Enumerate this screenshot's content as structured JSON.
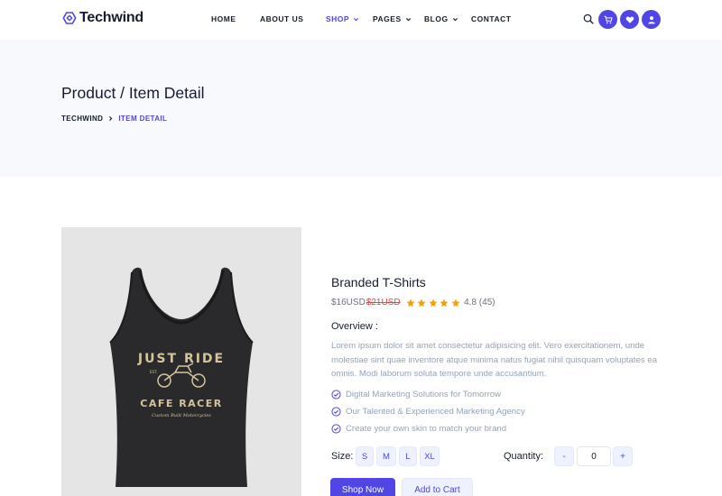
{
  "brand": {
    "name": "Techwind",
    "accent": "#4f46e5"
  },
  "nav": {
    "items": [
      {
        "label": "HOME",
        "dropdown": false,
        "active": false
      },
      {
        "label": "ABOUT US",
        "dropdown": false,
        "active": false
      },
      {
        "label": "SHOP",
        "dropdown": true,
        "active": true
      },
      {
        "label": "PAGES",
        "dropdown": true,
        "active": false
      },
      {
        "label": "BLOG",
        "dropdown": true,
        "active": false
      },
      {
        "label": "CONTACT",
        "dropdown": false,
        "active": false
      }
    ],
    "icons": [
      "search-icon",
      "cart-icon",
      "heart-icon",
      "user-icon"
    ]
  },
  "hero": {
    "title": "Product / Item Detail",
    "breadcrumb": {
      "home": "TECHWIND",
      "current": "ITEM DETAIL"
    }
  },
  "product": {
    "image": {
      "text": {
        "line1": "JUST RIDE",
        "est": "EST.",
        "line2": "CAFE RACER",
        "tagline": "Custom Built Motorcycles"
      }
    },
    "name": "Branded T-Shirts",
    "price": "$16USD",
    "old_price": "$21USD",
    "stars": 5,
    "rating": "4.8 (45)",
    "overview_label": "Overview :",
    "overview_text": "Lorem ipsum dolor sit amet consectetur adipisicing elit. Vero exercitationem, unde molestiae sint quae inventore atque minima natus fugiat nihil quisquam voluptates ea omnis. Modi laborum soluta tempore unde accusantium.",
    "features": [
      "Digital Marketing Solutions for Tomorrow",
      "Our Talented & Experienced Marketing Agency",
      "Create your own skin to match your brand"
    ],
    "size_label": "Size:",
    "sizes": [
      "S",
      "M",
      "L",
      "XL"
    ],
    "quantity_label": "Quantity:",
    "quantity": {
      "minus": "-",
      "value": "0",
      "plus": "+"
    },
    "shop_now": "Shop Now",
    "add_to_cart": "Add to Cart"
  }
}
